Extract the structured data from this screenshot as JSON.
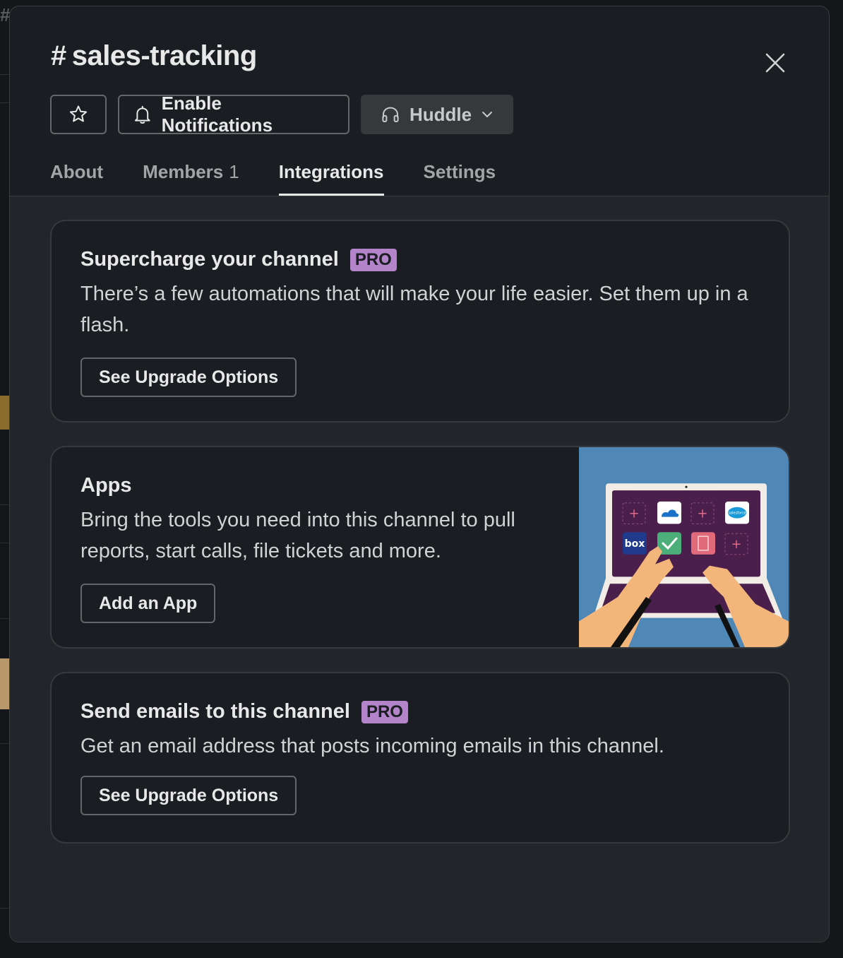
{
  "channel": {
    "hash": "#",
    "name": "sales-tracking"
  },
  "header": {
    "notifications_label": "Enable Notifications",
    "huddle_label": "Huddle"
  },
  "tabs": [
    {
      "label": "About"
    },
    {
      "label": "Members",
      "count": "1"
    },
    {
      "label": "Integrations"
    },
    {
      "label": "Settings"
    }
  ],
  "cards": {
    "supercharge": {
      "title": "Supercharge your channel",
      "badge": "PRO",
      "description": "There’s a few automations that will make your life easier. Set them up in a flash.",
      "button": "See Upgrade Options"
    },
    "apps": {
      "title": "Apps",
      "description": "Bring the tools you need into this channel to pull reports, start calls, file tickets and more.",
      "button": "Add an App",
      "app_tiles": [
        "box",
        "salesforce"
      ]
    },
    "emails": {
      "title": "Send emails to this channel",
      "badge": "PRO",
      "description": "Get an email address that posts incoming emails in this channel.",
      "button": "See Upgrade Options"
    }
  },
  "icons": {
    "star": "star-icon",
    "bell": "bell-icon",
    "headphones": "headphones-icon",
    "chevron": "chevron-down-icon",
    "close": "close-icon"
  },
  "colors": {
    "modal_bg": "#1a1d21",
    "body_bg": "#222529",
    "pro_badge": "#b384c9",
    "illustration_bg": "#4f88b6",
    "laptop_screen": "#4a1f4b"
  }
}
